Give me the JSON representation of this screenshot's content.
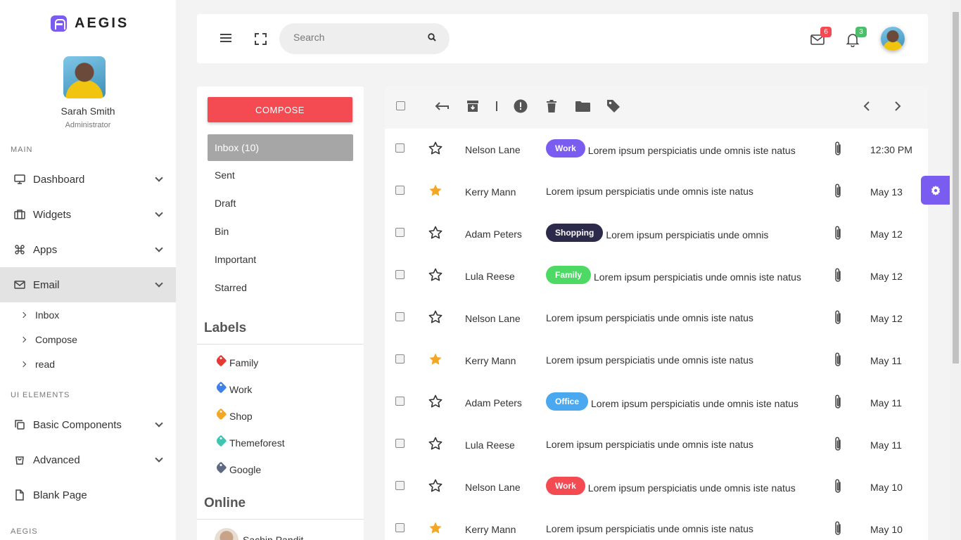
{
  "brand": {
    "name": "AEGIS"
  },
  "profile": {
    "name": "Sarah Smith",
    "role": "Administrator"
  },
  "sidebar": {
    "main_header": "MAIN",
    "items": [
      {
        "label": "Dashboard",
        "icon": "monitor-icon"
      },
      {
        "label": "Widgets",
        "icon": "briefcase-icon"
      },
      {
        "label": "Apps",
        "icon": "command-icon"
      },
      {
        "label": "Email",
        "icon": "mail-icon"
      }
    ],
    "email_sub": [
      "Inbox",
      "Compose",
      "read"
    ],
    "ui_header": "UI ELEMENTS",
    "ui_items": [
      {
        "label": "Basic Components",
        "icon": "copy-icon"
      },
      {
        "label": "Advanced",
        "icon": "shopping-bag-icon"
      },
      {
        "label": "Blank Page",
        "icon": "file-icon"
      }
    ],
    "aegis_header": "AEGIS"
  },
  "header": {
    "search_placeholder": "Search",
    "mail_count": "6",
    "notification_count": "3"
  },
  "folders": {
    "compose_label": "COMPOSE",
    "items": [
      "Inbox (10)",
      "Sent",
      "Draft",
      "Bin",
      "Important",
      "Starred"
    ],
    "labels_title": "Labels",
    "labels": [
      {
        "name": "Family",
        "color": "#e53935"
      },
      {
        "name": "Work",
        "color": "#3f7fe8"
      },
      {
        "name": "Shop",
        "color": "#f5a623"
      },
      {
        "name": "Themeforest",
        "color": "#3cc6b2"
      },
      {
        "name": "Google",
        "color": "#5d6a82"
      }
    ],
    "online_title": "Online",
    "online_users": [
      "Sachin Pandit"
    ]
  },
  "mails": [
    {
      "sender": "Nelson Lane",
      "tag": "Work",
      "tag_color": "#7b5cf0",
      "subject": "Lorem ipsum perspiciatis unde omnis iste natus",
      "time": "12:30 PM",
      "starred": false
    },
    {
      "sender": "Kerry Mann",
      "tag": "",
      "tag_color": "",
      "subject": "Lorem ipsum perspiciatis unde omnis iste natus",
      "time": "May 13",
      "starred": true
    },
    {
      "sender": "Adam Peters",
      "tag": "Shopping",
      "tag_color": "#2c2a4a",
      "subject": "Lorem ipsum perspiciatis unde omnis",
      "time": "May 12",
      "starred": false
    },
    {
      "sender": "Lula Reese",
      "tag": "Family",
      "tag_color": "#4cd964",
      "subject": "Lorem ipsum perspiciatis unde omnis iste natus",
      "time": "May 12",
      "starred": false
    },
    {
      "sender": "Nelson Lane",
      "tag": "",
      "tag_color": "",
      "subject": "Lorem ipsum perspiciatis unde omnis iste natus",
      "time": "May 12",
      "starred": false
    },
    {
      "sender": "Kerry Mann",
      "tag": "",
      "tag_color": "",
      "subject": "Lorem ipsum perspiciatis unde omnis iste natus",
      "time": "May 11",
      "starred": true
    },
    {
      "sender": "Adam Peters",
      "tag": "Office",
      "tag_color": "#4aa8f0",
      "subject": "Lorem ipsum perspiciatis unde omnis iste natus",
      "time": "May 11",
      "starred": false
    },
    {
      "sender": "Lula Reese",
      "tag": "",
      "tag_color": "",
      "subject": "Lorem ipsum perspiciatis unde omnis iste natus",
      "time": "May 11",
      "starred": false
    },
    {
      "sender": "Nelson Lane",
      "tag": "Work",
      "tag_color": "#f44a52",
      "subject": "Lorem ipsum perspiciatis unde omnis iste natus",
      "time": "May 10",
      "starred": false
    },
    {
      "sender": "Kerry Mann",
      "tag": "",
      "tag_color": "",
      "subject": "Lorem ipsum perspiciatis unde omnis iste natus",
      "time": "May 10",
      "starred": true
    }
  ],
  "colors": {
    "accent": "#7b5cf0",
    "compose": "#f44a52",
    "star": "#f5a623",
    "mail_badge": "#f44a52",
    "notification_badge": "#4cbe6c"
  }
}
